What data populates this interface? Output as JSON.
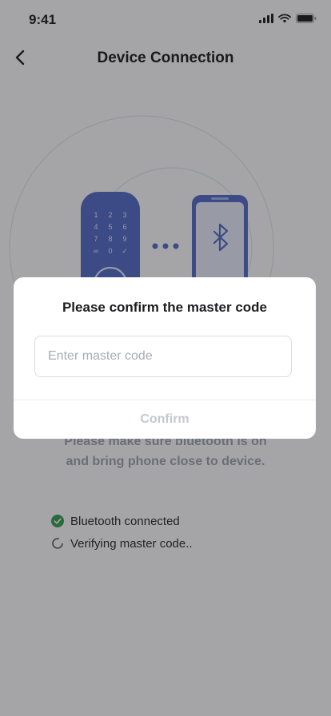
{
  "status_bar": {
    "time": "9:41"
  },
  "nav": {
    "title": "Device Connection"
  },
  "illustration": {
    "keypad_rows": [
      [
        "1",
        "2",
        "3"
      ],
      [
        "4",
        "5",
        "6"
      ],
      [
        "7",
        "8",
        "9"
      ],
      [
        "∞",
        "0",
        "✓"
      ]
    ]
  },
  "hint": {
    "line1": "Please make sure bluetooth is on",
    "line2": "and bring phone close to device."
  },
  "status_items": [
    {
      "label": "Bluetooth connected",
      "state": "done",
      "icon": "check-circle-icon"
    },
    {
      "label": "Verifying master code..",
      "state": "pending",
      "icon": "loading-spinner-icon"
    }
  ],
  "modal": {
    "title": "Please confirm the master code",
    "input_placeholder": "Enter master code",
    "input_value": "",
    "confirm_label": "Confirm"
  },
  "colors": {
    "accent": "#4a63c7",
    "success": "#2e9a48",
    "disabled": "#c4c8d0"
  }
}
